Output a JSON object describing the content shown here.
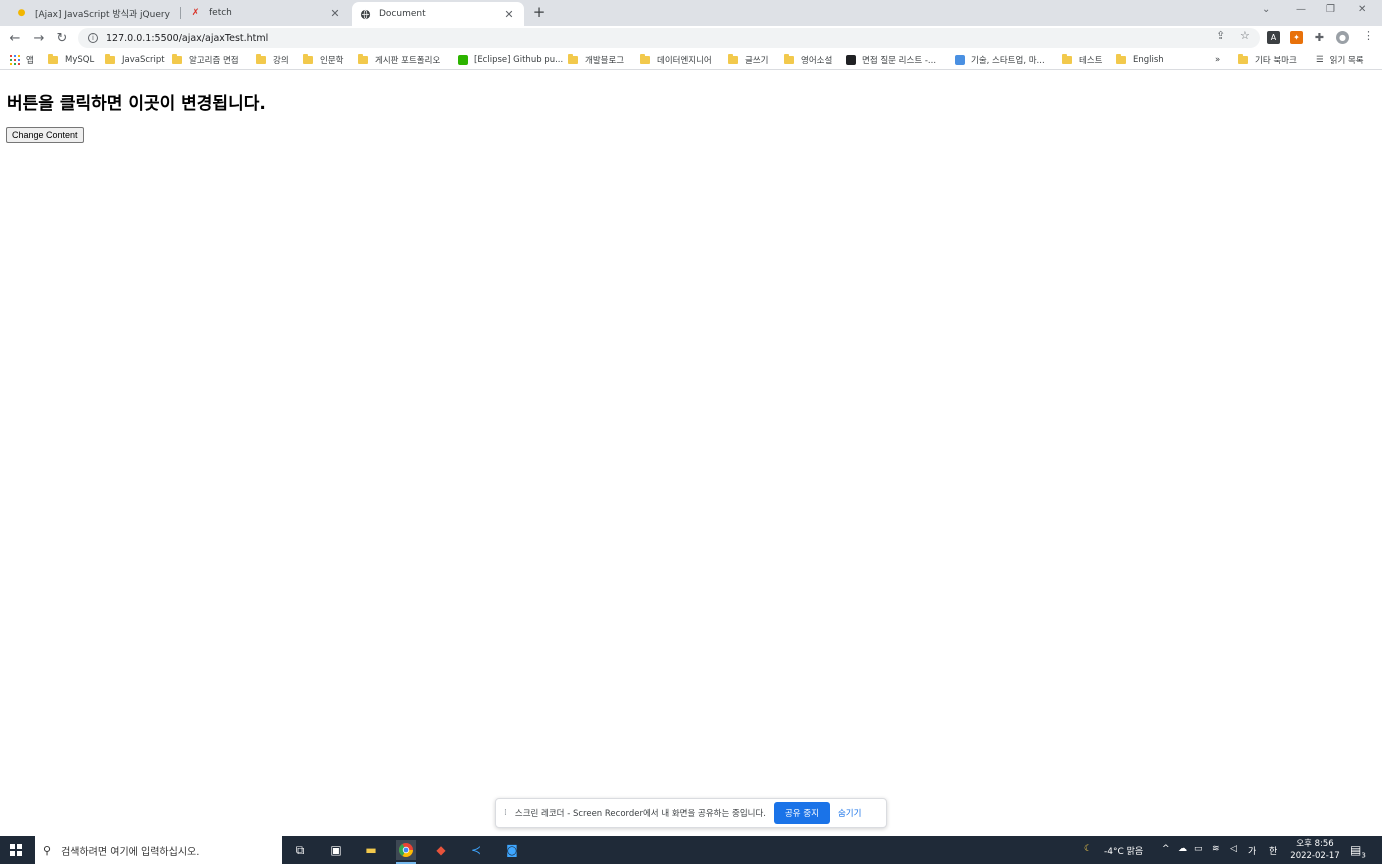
{
  "browser": {
    "tabs": [
      {
        "title": "[Ajax] JavaScript 방식과 jQuery",
        "active": false
      },
      {
        "title": "fetch",
        "active": false
      },
      {
        "title": "Document",
        "active": true
      }
    ],
    "new_tab_label": "+",
    "url": "127.0.0.1:5500/ajax/ajaxTest.html",
    "bookmarks": [
      {
        "label": "앱",
        "type": "apps"
      },
      {
        "label": "MySQL",
        "type": "folder"
      },
      {
        "label": "JavaScript",
        "type": "folder"
      },
      {
        "label": "알고리즘 면접",
        "type": "folder"
      },
      {
        "label": "강의",
        "type": "folder"
      },
      {
        "label": "인문학",
        "type": "folder"
      },
      {
        "label": "게시판 포트폴리오",
        "type": "folder"
      },
      {
        "label": "[Eclipse] Github pu...",
        "type": "site",
        "color": "#2db400"
      },
      {
        "label": "개발블로그",
        "type": "folder"
      },
      {
        "label": "데이터엔지니어",
        "type": "folder"
      },
      {
        "label": "글쓰기",
        "type": "folder"
      },
      {
        "label": "영어소설",
        "type": "folder"
      },
      {
        "label": "면접 질문 리스트 -...",
        "type": "site",
        "color": "#202124"
      },
      {
        "label": "기술, 스타트업, 마...",
        "type": "site",
        "color": "#4a90e2"
      },
      {
        "label": "테스트",
        "type": "folder"
      },
      {
        "label": "English",
        "type": "folder"
      }
    ],
    "bookmarks_overflow": "»",
    "other_bookmarks": "기타 북마크",
    "reading_list": "읽기 목록"
  },
  "page": {
    "heading": "버튼을 클릭하면 이곳이 변경됩니다.",
    "button_label": "Change Content"
  },
  "share_bar": {
    "grip": "⁞",
    "message": "스크린 레코더 - Screen Recorder에서 내 화면을 공유하는 중입니다.",
    "stop_label": "공유 중지",
    "hide_label": "숨기기"
  },
  "taskbar": {
    "search_placeholder": "검색하려면 여기에 입력하십시오.",
    "weather": "-4°C  맑음",
    "ime_lang": "가",
    "ime_mode": "한",
    "time": "오후 8:56",
    "date": "2022-02-17",
    "notification_count": "3"
  },
  "colors": {
    "tabstrip": "#dee1e6",
    "taskbar": "#1f2a38",
    "accent": "#1a73e8",
    "folder": "#f2c94c"
  }
}
